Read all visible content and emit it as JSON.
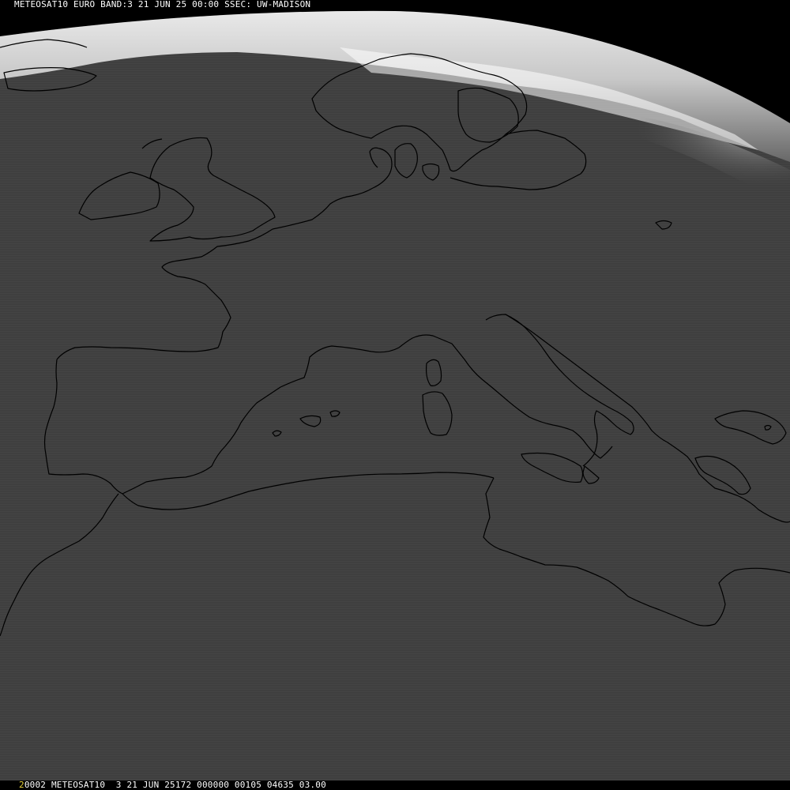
{
  "header": {
    "text": "METEOSAT10 EURO BAND:3 21 JUN 25 00:00 SSEC: UW-MADISON"
  },
  "footer": {
    "frame_number": "2",
    "info": "0002 METEOSAT10  3 21 JUN 25172 000000 00105 04635 03.00"
  },
  "colors": {
    "space": "#000000",
    "surface": "#404040",
    "cloud_top": "#e6e6e6",
    "coastline": "#000000",
    "frame_number": "#e8d33a",
    "text": "#ffffff"
  }
}
